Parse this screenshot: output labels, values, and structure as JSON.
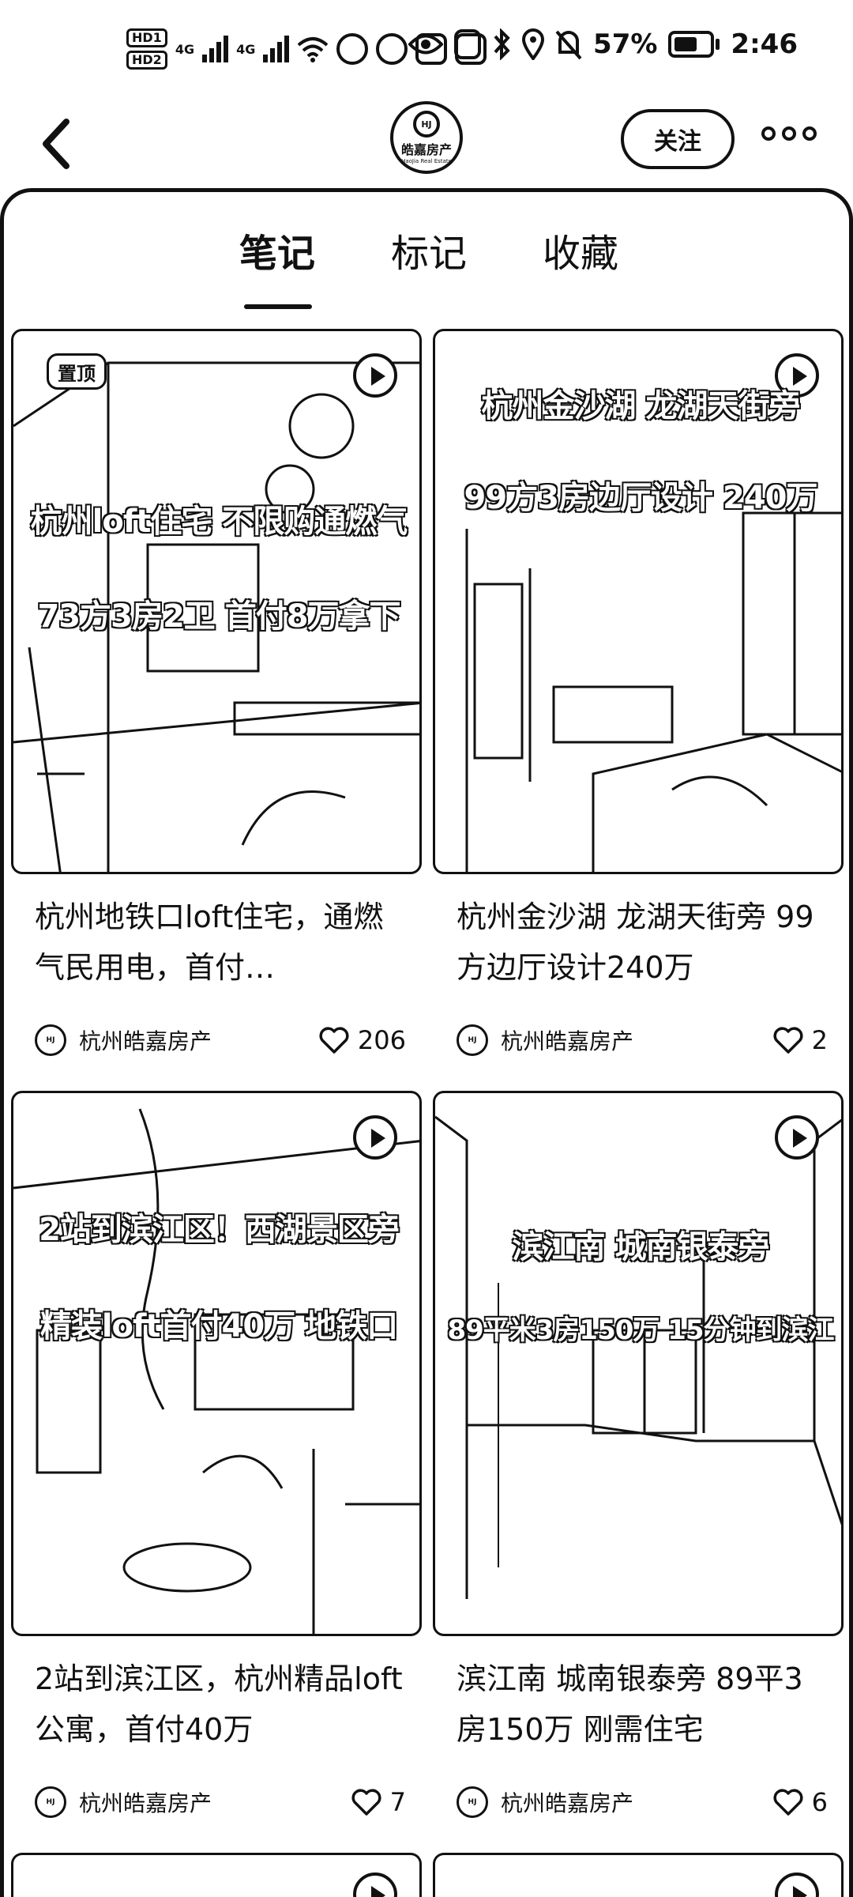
{
  "status_bar": {
    "hd1": "HD1",
    "hd2": "HD2",
    "net1": "4G",
    "net2": "4G",
    "battery": "57%",
    "time": "2:46"
  },
  "header": {
    "logo_cn": "皓嘉房产",
    "logo_en": "HaoJia Real Estate",
    "logo_mark": "HJ",
    "follow_label": "关注"
  },
  "tabs": [
    {
      "label": "笔记",
      "active": true
    },
    {
      "label": "标记",
      "active": false
    },
    {
      "label": "收藏",
      "active": false
    }
  ],
  "notes": [
    {
      "pinned_label": "置顶",
      "overlay_lines": [
        "杭州loft住宅 不限购通燃气",
        "73方3房2卫 首付8万拿下"
      ],
      "title": "杭州地铁口loft住宅，通燃气民用电，首付…",
      "author": "杭州皓嘉房产",
      "likes": "206"
    },
    {
      "pinned_label": "",
      "overlay_lines": [
        "杭州金沙湖 龙湖天街旁",
        "99方3房边厅设计 240万"
      ],
      "title": "杭州金沙湖 龙湖天街旁 99方边厅设计240万",
      "author": "杭州皓嘉房产",
      "likes": "2"
    },
    {
      "pinned_label": "",
      "overlay_lines": [
        "2站到滨江区！西湖景区旁",
        "精装loft首付40万 地铁口"
      ],
      "title": "2站到滨江区，杭州精品loft公寓，首付40万",
      "author": "杭州皓嘉房产",
      "likes": "7"
    },
    {
      "pinned_label": "",
      "overlay_lines": [
        "滨江南  城南银泰旁",
        "89平米3房150万 15分钟到滨江"
      ],
      "title": "滨江南 城南银泰旁 89平3房150万 刚需住宅",
      "author": "杭州皓嘉房产",
      "likes": "6"
    }
  ]
}
